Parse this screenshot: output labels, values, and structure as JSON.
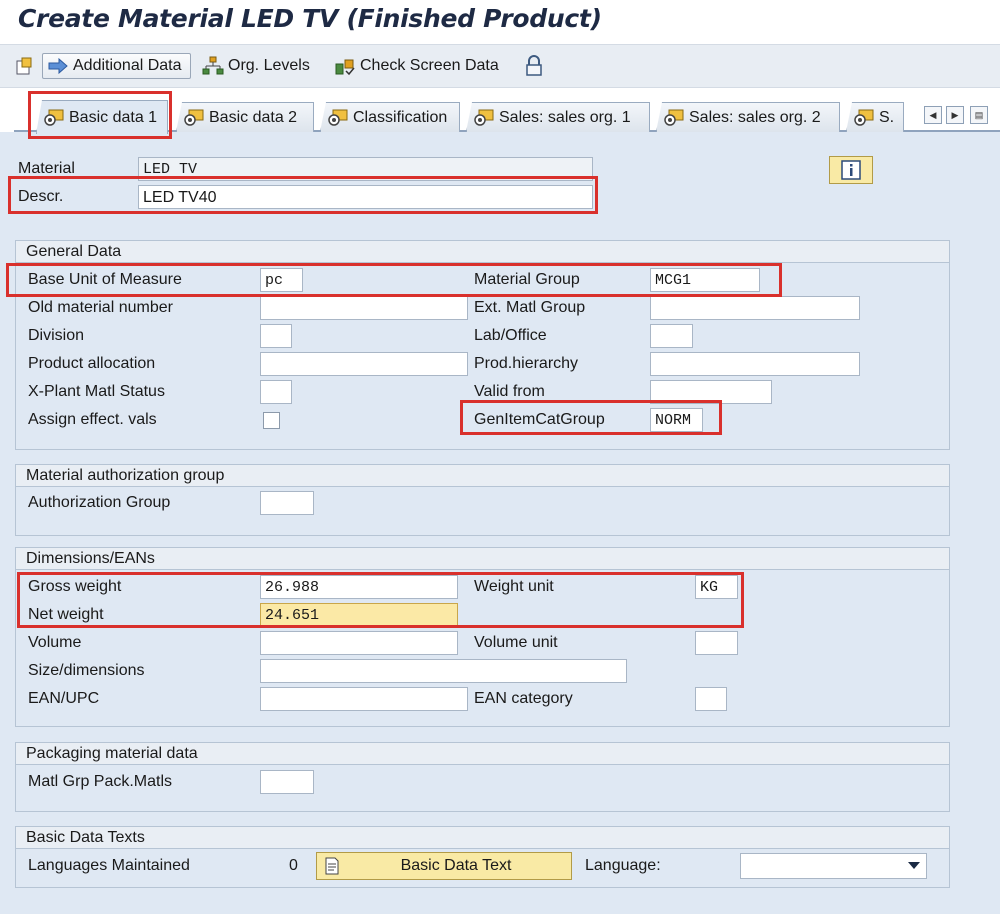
{
  "window": {
    "title": "Create Material LED TV (Finished Product)"
  },
  "toolbar": {
    "additional_data": "Additional Data",
    "org_levels": "Org. Levels",
    "check_screen_data": "Check Screen Data"
  },
  "tabs": [
    {
      "label": "Basic data 1",
      "active": true
    },
    {
      "label": "Basic data 2"
    },
    {
      "label": "Classification"
    },
    {
      "label": "Sales: sales org. 1"
    },
    {
      "label": "Sales: sales org. 2"
    },
    {
      "label": "S."
    }
  ],
  "header": {
    "material_label": "Material",
    "material_value": "LED TV",
    "descr_label": "Descr.",
    "descr_value": "LED TV40"
  },
  "general_data": {
    "title": "General Data",
    "base_uom_label": "Base Unit of Measure",
    "base_uom_value": "pc",
    "old_matnr_label": "Old material number",
    "division_label": "Division",
    "product_allocation_label": "Product allocation",
    "xplant_status_label": "X-Plant Matl Status",
    "assign_effect_label": "Assign effect. vals",
    "material_group_label": "Material Group",
    "material_group_value": "MCG1",
    "ext_matl_group_label": "Ext. Matl Group",
    "lab_office_label": "Lab/Office",
    "prod_hierarchy_label": "Prod.hierarchy",
    "valid_from_label": "Valid from",
    "gen_item_cat_label": "GenItemCatGroup",
    "gen_item_cat_value": "NORM"
  },
  "auth_group": {
    "title": "Material authorization group",
    "authorization_group_label": "Authorization Group"
  },
  "dimensions": {
    "title": "Dimensions/EANs",
    "gross_weight_label": "Gross weight",
    "gross_weight_value": "26.988",
    "weight_unit_label": "Weight unit",
    "weight_unit_value": "KG",
    "net_weight_label": "Net weight",
    "net_weight_value": "24.651",
    "volume_label": "Volume",
    "volume_unit_label": "Volume unit",
    "size_label": "Size/dimensions",
    "ean_label": "EAN/UPC",
    "ean_category_label": "EAN category"
  },
  "packaging": {
    "title": "Packaging material data",
    "matl_grp_pack_label": "Matl Grp Pack.Matls"
  },
  "texts": {
    "title": "Basic Data Texts",
    "languages_label": "Languages Maintained",
    "languages_count": "0",
    "basic_data_text_button": "Basic Data Text",
    "language_label": "Language:"
  },
  "colors": {
    "background": "#dfe8f3",
    "highlight_field": "#fbe9a6",
    "annotation_red": "#d9302c",
    "button_yellow": "#f9eaa5"
  }
}
